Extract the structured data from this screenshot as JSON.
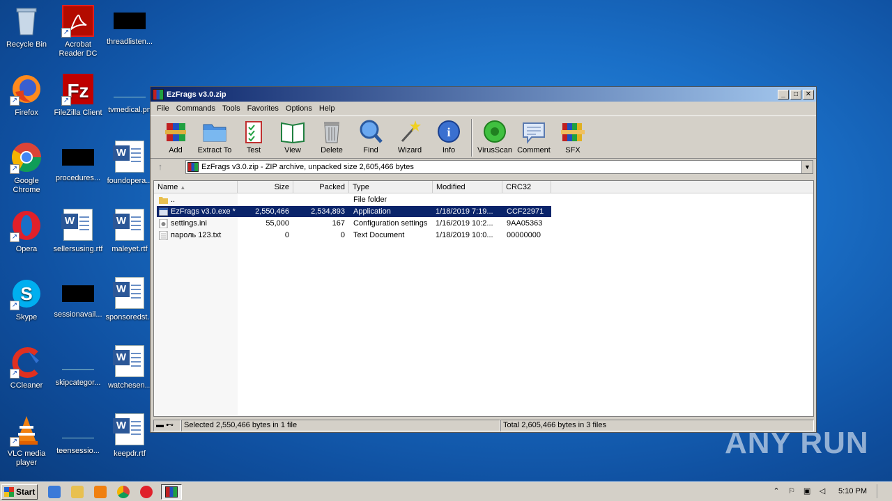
{
  "desktop": {
    "icons": [
      {
        "label": "Recycle Bin"
      },
      {
        "label": "Acrobat Reader DC"
      },
      {
        "label": "threadlisten..."
      },
      {
        "label": "Firefox"
      },
      {
        "label": "FileZilla Client"
      },
      {
        "label": "tvmedical.pn"
      },
      {
        "label": "Google Chrome"
      },
      {
        "label": "procedures..."
      },
      {
        "label": "foundopera..."
      },
      {
        "label": "Opera"
      },
      {
        "label": "sellersusing.rtf"
      },
      {
        "label": "maleyet.rtf"
      },
      {
        "label": "Skype"
      },
      {
        "label": "sessionavail..."
      },
      {
        "label": "sponsoredst..."
      },
      {
        "label": "CCleaner"
      },
      {
        "label": "skipcategor..."
      },
      {
        "label": "watchesen..."
      },
      {
        "label": "VLC media player"
      },
      {
        "label": "teensessio..."
      },
      {
        "label": "keepdr.rtf"
      }
    ]
  },
  "window": {
    "title": "EzFrags v3.0.zip",
    "menu": [
      "File",
      "Commands",
      "Tools",
      "Favorites",
      "Options",
      "Help"
    ],
    "toolbar": [
      {
        "label": "Add",
        "icon": "add-icon"
      },
      {
        "label": "Extract To",
        "icon": "extract-icon"
      },
      {
        "label": "Test",
        "icon": "test-icon"
      },
      {
        "label": "View",
        "icon": "view-icon"
      },
      {
        "label": "Delete",
        "icon": "delete-icon"
      },
      {
        "label": "Find",
        "icon": "find-icon"
      },
      {
        "label": "Wizard",
        "icon": "wizard-icon"
      },
      {
        "label": "Info",
        "icon": "info-icon"
      },
      {
        "label": "VirusScan",
        "icon": "virusscan-icon"
      },
      {
        "label": "Comment",
        "icon": "comment-icon"
      },
      {
        "label": "SFX",
        "icon": "sfx-icon"
      }
    ],
    "address": "EzFrags v3.0.zip - ZIP archive, unpacked size 2,605,466 bytes",
    "columns": [
      "Name",
      "Size",
      "Packed",
      "Type",
      "Modified",
      "CRC32"
    ],
    "rows": [
      {
        "name": "..",
        "size": "",
        "packed": "",
        "type": "File folder",
        "modified": "",
        "crc": "",
        "icon": "folder-icon"
      },
      {
        "name": "EzFrags v3.0.exe *",
        "size": "2,550,466",
        "packed": "2,534,893",
        "type": "Application",
        "modified": "1/18/2019 7:19...",
        "crc": "CCF22971",
        "icon": "exe-icon"
      },
      {
        "name": "settings.ini",
        "size": "55,000",
        "packed": "167",
        "type": "Configuration settings",
        "modified": "1/16/2019 10:2...",
        "crc": "9AA05363",
        "icon": "ini-icon"
      },
      {
        "name": "пароль 123.txt",
        "size": "0",
        "packed": "0",
        "type": "Text Document",
        "modified": "1/18/2019 10:0...",
        "crc": "00000000",
        "icon": "txt-icon"
      }
    ],
    "status_left": "Selected 2,550,466 bytes in 1 file",
    "status_right": "Total 2,605,466 bytes in 3 files"
  },
  "taskbar": {
    "start_label": "Start",
    "clock": "5:10 PM"
  },
  "watermark": "ANY RUN"
}
